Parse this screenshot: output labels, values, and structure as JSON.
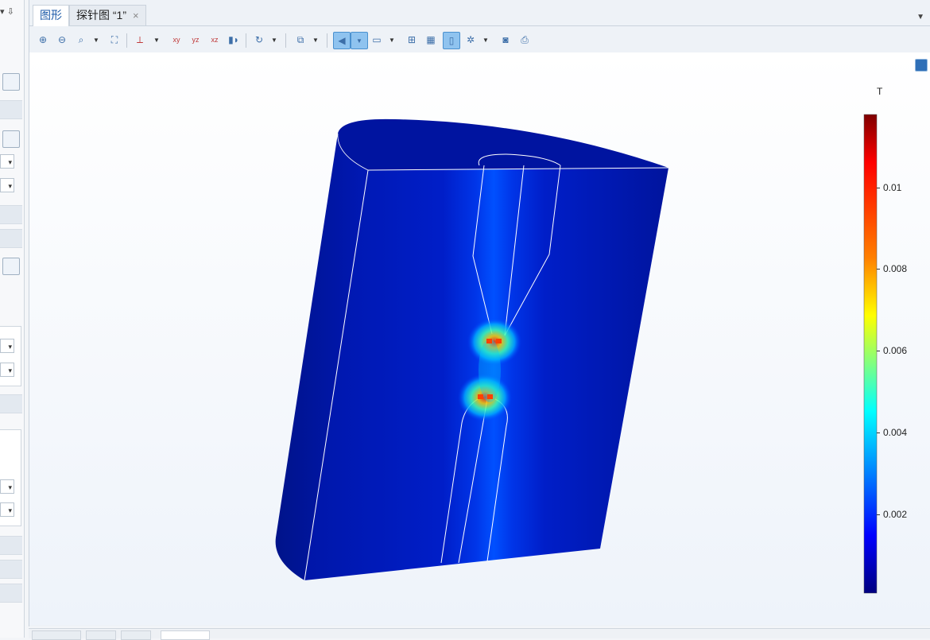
{
  "tabs": [
    {
      "label": "图形",
      "active": true
    },
    {
      "label": "探针图 “1”",
      "active": false,
      "close": "×"
    }
  ],
  "toolbar": {
    "icons": [
      "zoom-in-icon",
      "zoom-out-icon",
      "zoom-box-icon",
      "zoom-extents-icon",
      "axis-view-icon",
      "xy-view-icon",
      "yz-view-icon",
      "xz-view-icon",
      "camera-icon",
      "rotate-icon",
      "transparency-icon",
      "select-icon",
      "render-icon",
      "grid-icon",
      "wireframe-icon",
      "scene-light-icon",
      "snapshot-icon",
      "print-icon"
    ]
  },
  "colorbar": {
    "unit": "T",
    "ticks": [
      "0.01",
      "0.008",
      "0.006",
      "0.004",
      "0.002"
    ],
    "colors": [
      "#7f0000",
      "#ff0000",
      "#ff8000",
      "#ffff00",
      "#80ff80",
      "#00ffff",
      "#0080ff",
      "#0000ff",
      "#00007f"
    ]
  }
}
